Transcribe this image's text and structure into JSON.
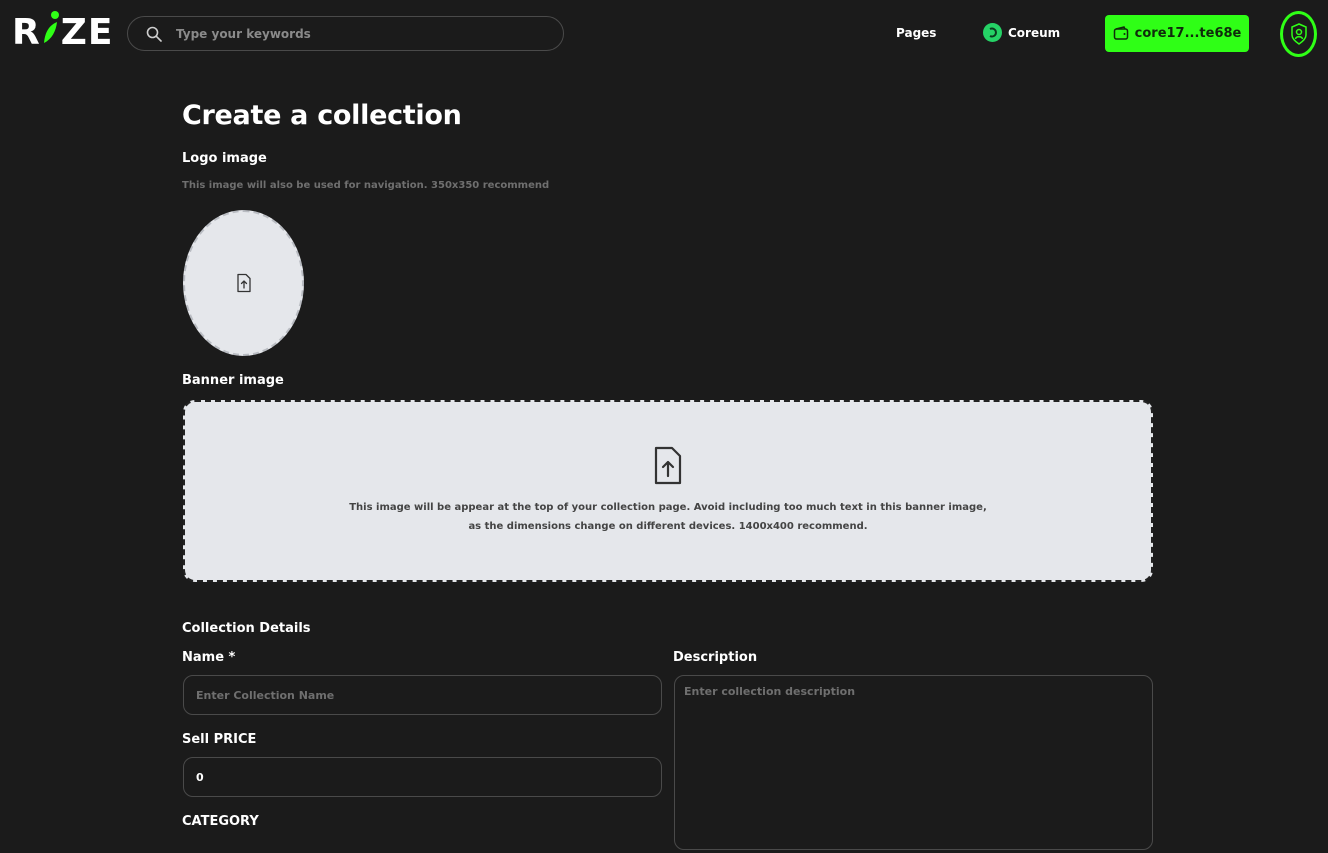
{
  "header": {
    "logo_text": "RIZE",
    "search_placeholder": "Type your keywords",
    "nav_pages": "Pages",
    "chain_name": "Coreum",
    "wallet_address": "core17...te68e",
    "accent_color": "#2fff16"
  },
  "page": {
    "title": "Create a collection",
    "logo_label": "Logo image",
    "logo_hint": "This image will also be used for navigation. 350x350 recommend",
    "banner_label": "Banner image",
    "banner_text_line1": "This image will be appear at the top of your collection page. Avoid including too much text in this banner image,",
    "banner_text_line2": "as the dimensions change on different devices. 1400x400 recommend.",
    "details_heading": "Collection Details",
    "name_label": "Name *",
    "name_placeholder": "Enter Collection Name",
    "description_label": "Description",
    "description_placeholder": "Enter collection description",
    "price_label": "Sell PRICE",
    "price_value": "0",
    "category_label": "CATEGORY"
  }
}
